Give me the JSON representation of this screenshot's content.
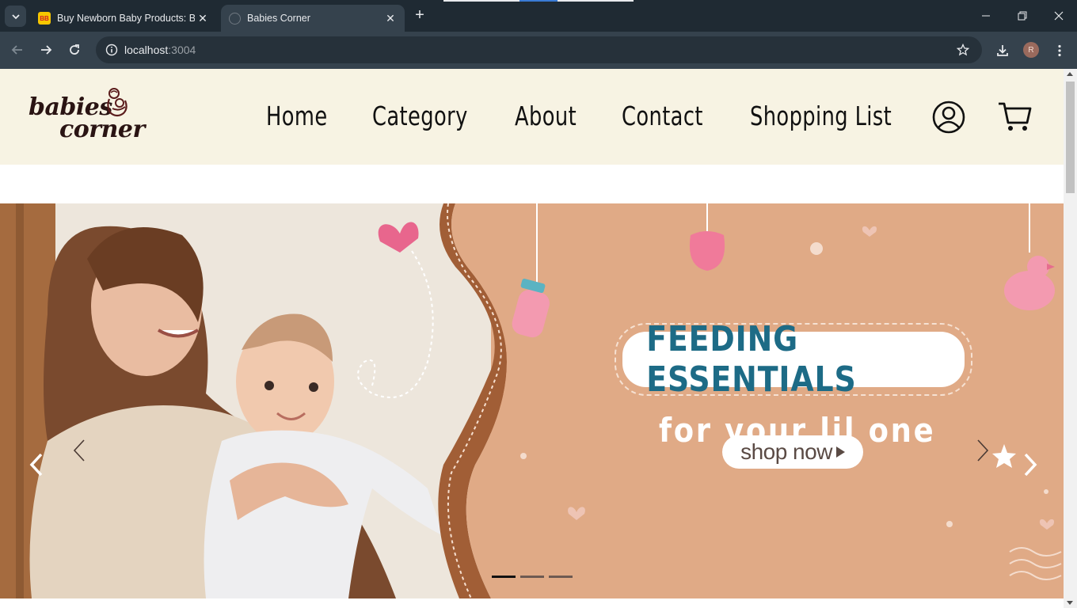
{
  "browser": {
    "tabs": [
      {
        "title": "Buy Newborn Baby Products: Be",
        "favicon": "BB",
        "active": false
      },
      {
        "title": "Babies Corner",
        "favicon": "globe-icon",
        "active": true
      }
    ],
    "new_tab_label": "+",
    "address": {
      "host": "localhost",
      "port": ":3004"
    },
    "profile_initial": "R"
  },
  "site": {
    "logo": {
      "line1": "babies",
      "line2": "corner"
    },
    "nav": [
      "Home",
      "Category",
      "About",
      "Contact",
      "Shopping List"
    ],
    "icons": [
      "user-icon",
      "cart-icon"
    ]
  },
  "banner": {
    "headline": "FEEDING ESSENTIALS",
    "tagline": "for your lil one",
    "cta": "shop now",
    "slides_total": 3,
    "active_slide": 1
  },
  "colors": {
    "header_bg": "#f7f3e3",
    "banner_peach": "#e0aa86",
    "headline_blue": "#1d6b86",
    "chrome_dark": "#1f2a33",
    "chrome_mid": "#35424d"
  }
}
